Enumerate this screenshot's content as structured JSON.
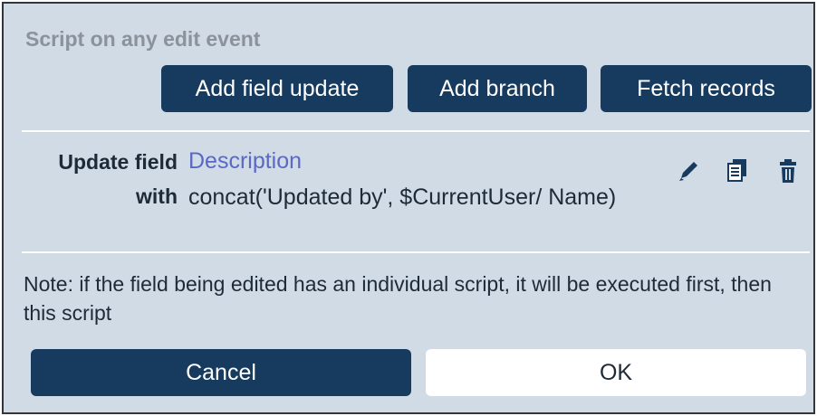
{
  "dialog": {
    "title": "Script on any edit event",
    "toolbar": {
      "add_field_update": "Add field update",
      "add_branch": "Add branch",
      "fetch_records": "Fetch records"
    },
    "rule": {
      "update_label": "Update field",
      "field": "Description",
      "with_label": "with",
      "expression": "concat('Updated by', $CurrentUser/ Name)",
      "actions": [
        "pencil-icon",
        "copy-icon",
        "trash-icon"
      ]
    },
    "note": "Note: if the field being edited has an individual script, it will be executed first, then this script",
    "footer": {
      "cancel": "Cancel",
      "ok": "OK"
    }
  },
  "colors": {
    "panel_bg": "#d0dbe6",
    "button_bg": "#173b5e",
    "link_color": "#5a68c6",
    "title_color": "#8b929a"
  }
}
